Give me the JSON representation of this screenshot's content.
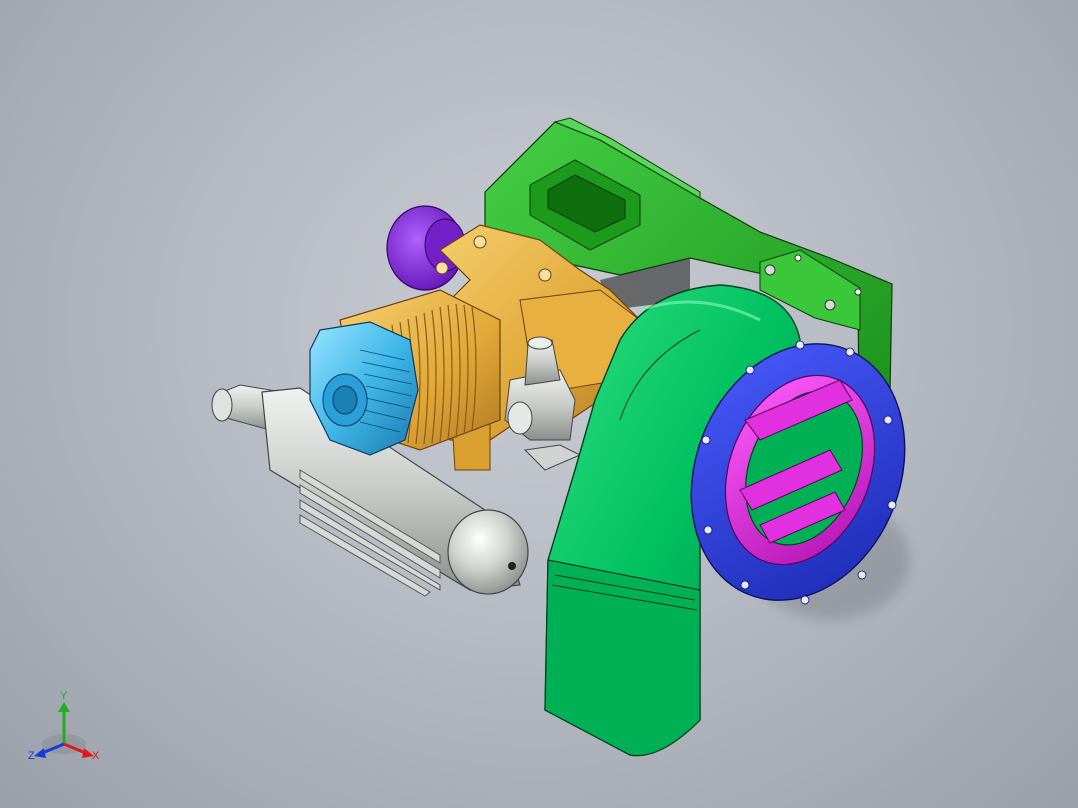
{
  "colors": {
    "background": "#b6bac2",
    "blower_housing": "#00c060",
    "mount_bracket": "#22b522",
    "engine_crankcase": "#e8b040",
    "cylinder_head": "#3fb8e8",
    "flange_ring": "#2a3bd6",
    "inner_ring": "#e020e0",
    "muffler": "#c8ccc8",
    "starter_cap": "#8a22d8"
  },
  "triad": {
    "x_label": "X",
    "y_label": "Y",
    "z_label": "Z",
    "x_color": "#e01818",
    "y_color": "#20b020",
    "z_color": "#1a3ad8"
  }
}
